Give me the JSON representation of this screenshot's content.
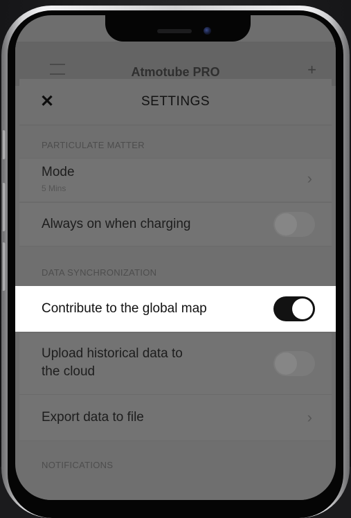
{
  "app": {
    "title": "Atmotube PRO"
  },
  "settings": {
    "title": "SETTINGS",
    "sections": {
      "particulate": "PARTICULATE MATTER",
      "data_sync": "DATA SYNCHRONIZATION",
      "notifications": "NOTIFICATIONS"
    },
    "mode": {
      "label": "Mode",
      "value": "5 Mins"
    },
    "always_on_charging": {
      "label": "Always on when charging",
      "enabled": false
    },
    "contribute_global_map": {
      "label": "Contribute to the global map",
      "enabled": true
    },
    "upload_history": {
      "label_line1": "Upload historical data to",
      "label_line2": "the cloud",
      "enabled": false
    },
    "export_data": {
      "label": "Export data to file"
    }
  },
  "icons": {
    "close": "close-icon",
    "chevron": "chevron-right-icon",
    "menu": "menu-icon",
    "add": "plus-icon"
  },
  "colors": {
    "highlight_row": "#ffffff",
    "toggle_on": "#121212",
    "dim_overlay": "#6f6f6f"
  }
}
